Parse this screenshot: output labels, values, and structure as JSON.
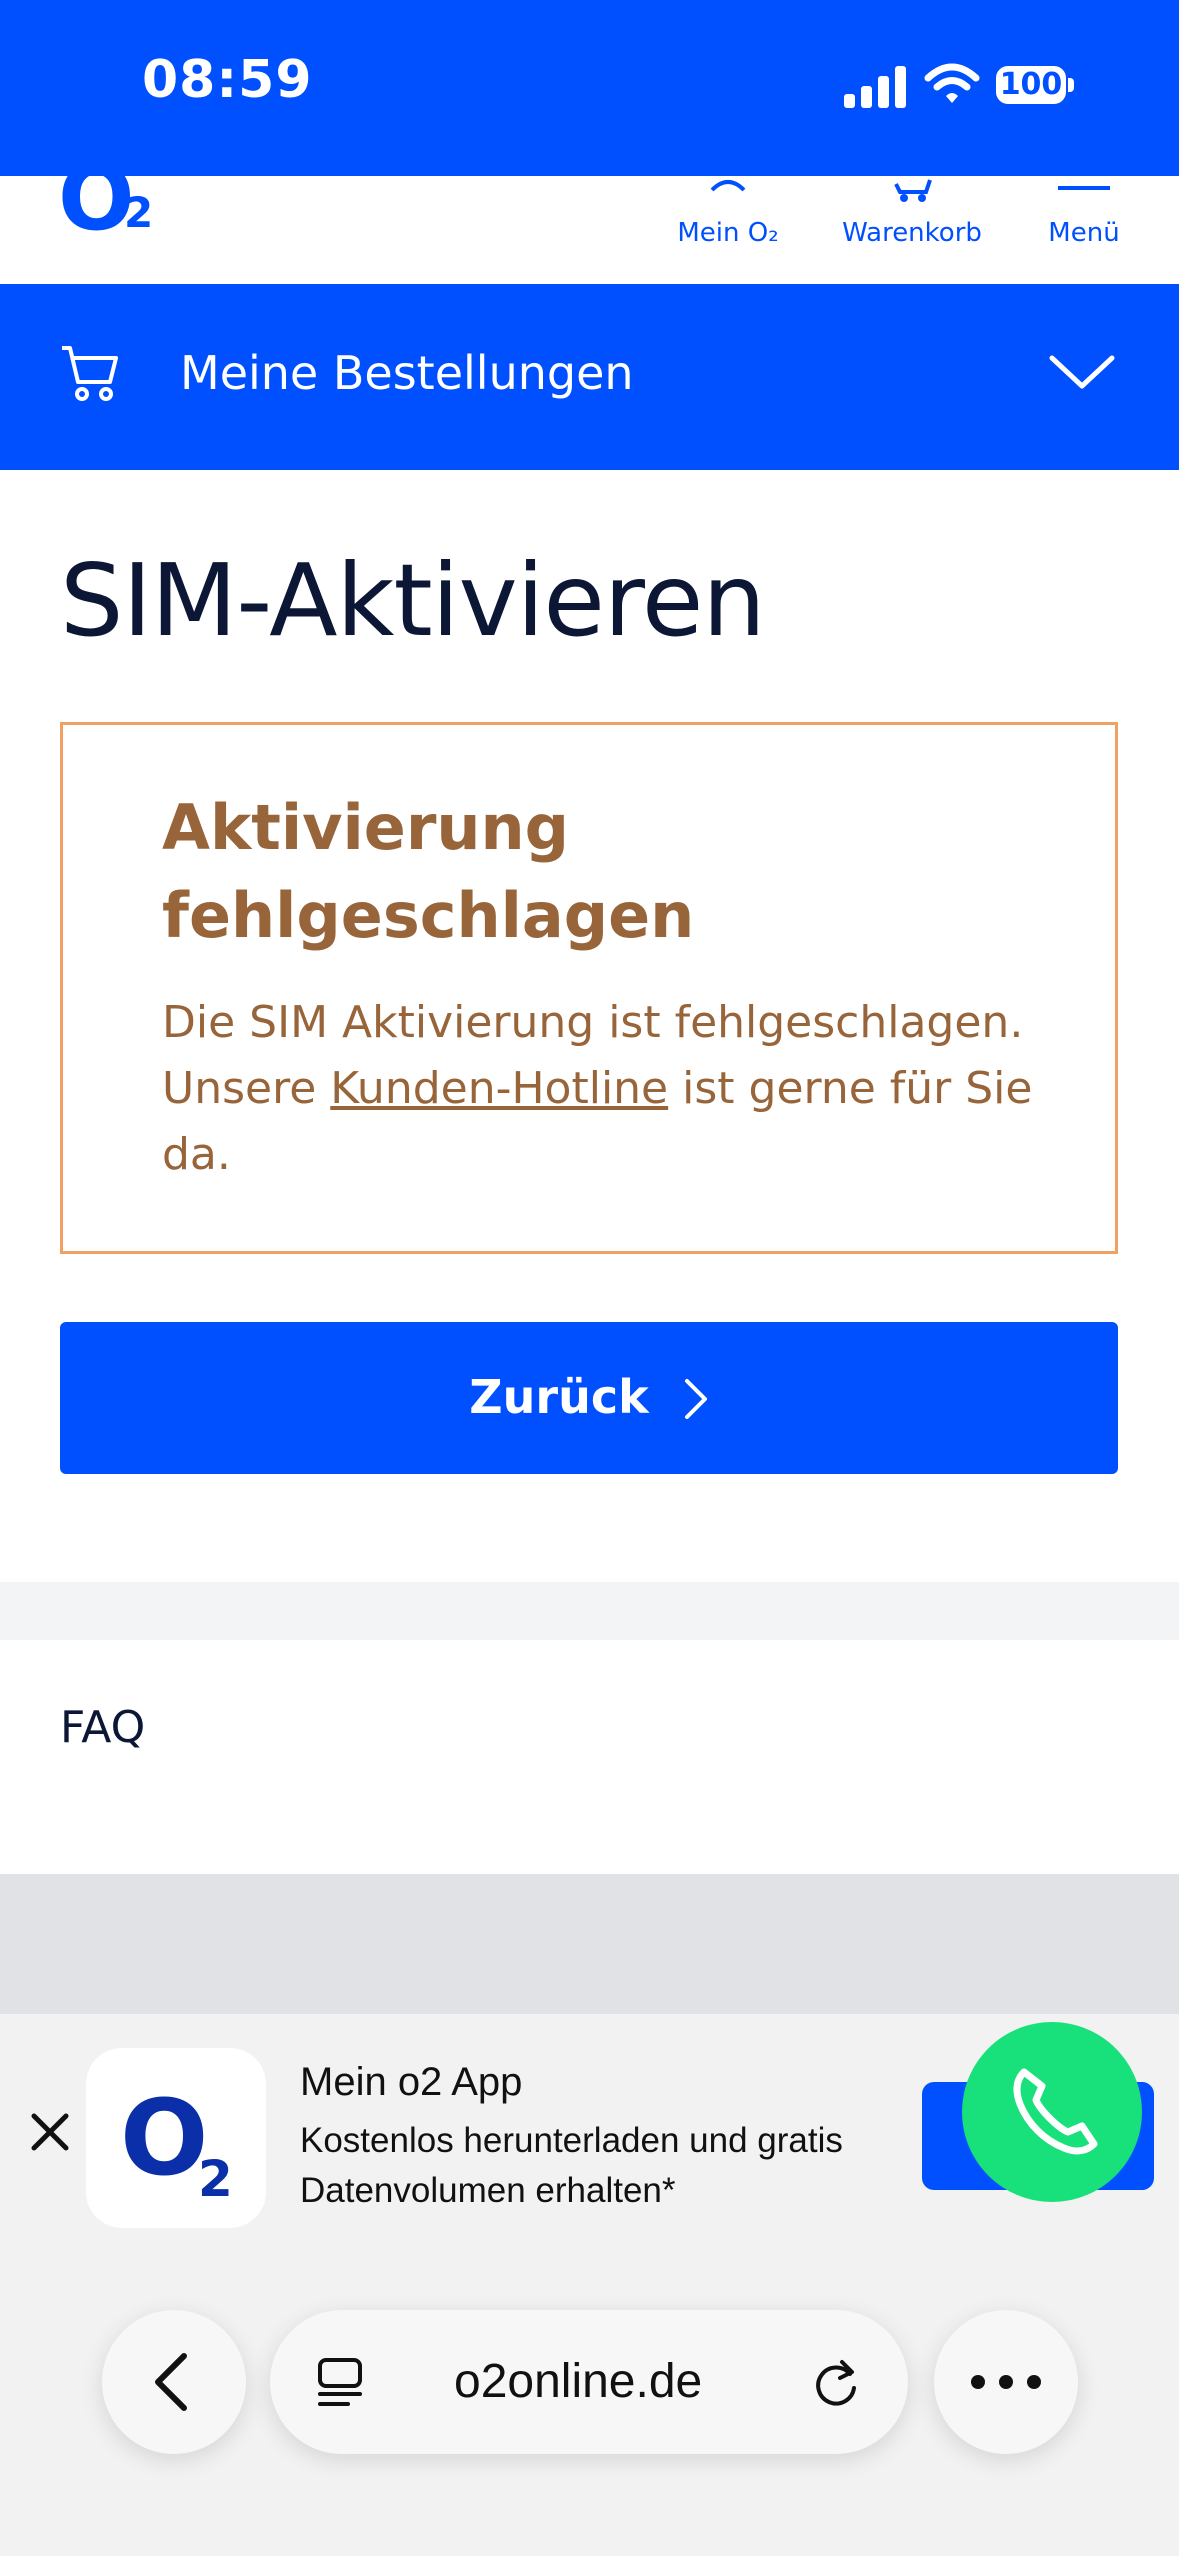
{
  "status_bar": {
    "time": "08:59",
    "battery": "100"
  },
  "header": {
    "logo": "O",
    "logo_sub": "2",
    "nav": [
      {
        "label": "Mein O₂"
      },
      {
        "label": "Warenkorb"
      },
      {
        "label": "Menü"
      }
    ]
  },
  "orders_bar": {
    "label": "Meine Bestellungen"
  },
  "main": {
    "title": "SIM-Aktivieren",
    "error": {
      "title": "Aktivierung fehlgeschlagen",
      "text_before": "Die SIM Aktivierung ist fehlgeschlagen. Unsere ",
      "link": "Kunden-Hotline",
      "text_after": " ist gerne für Sie da."
    },
    "back_button": "Zurück"
  },
  "faq": {
    "label": "FAQ"
  },
  "app_banner": {
    "title": "Mein o2 App",
    "subtitle": "Kostenlos herunterladen und gratis Datenvolumen erhalten*",
    "logo": "O",
    "logo_sub": "2"
  },
  "browser": {
    "url": "o2online.de"
  },
  "colors": {
    "brand_blue": "#0050ff",
    "error_brown": "#98653a",
    "error_border": "#f0a060",
    "fab_green": "#18e07a"
  }
}
